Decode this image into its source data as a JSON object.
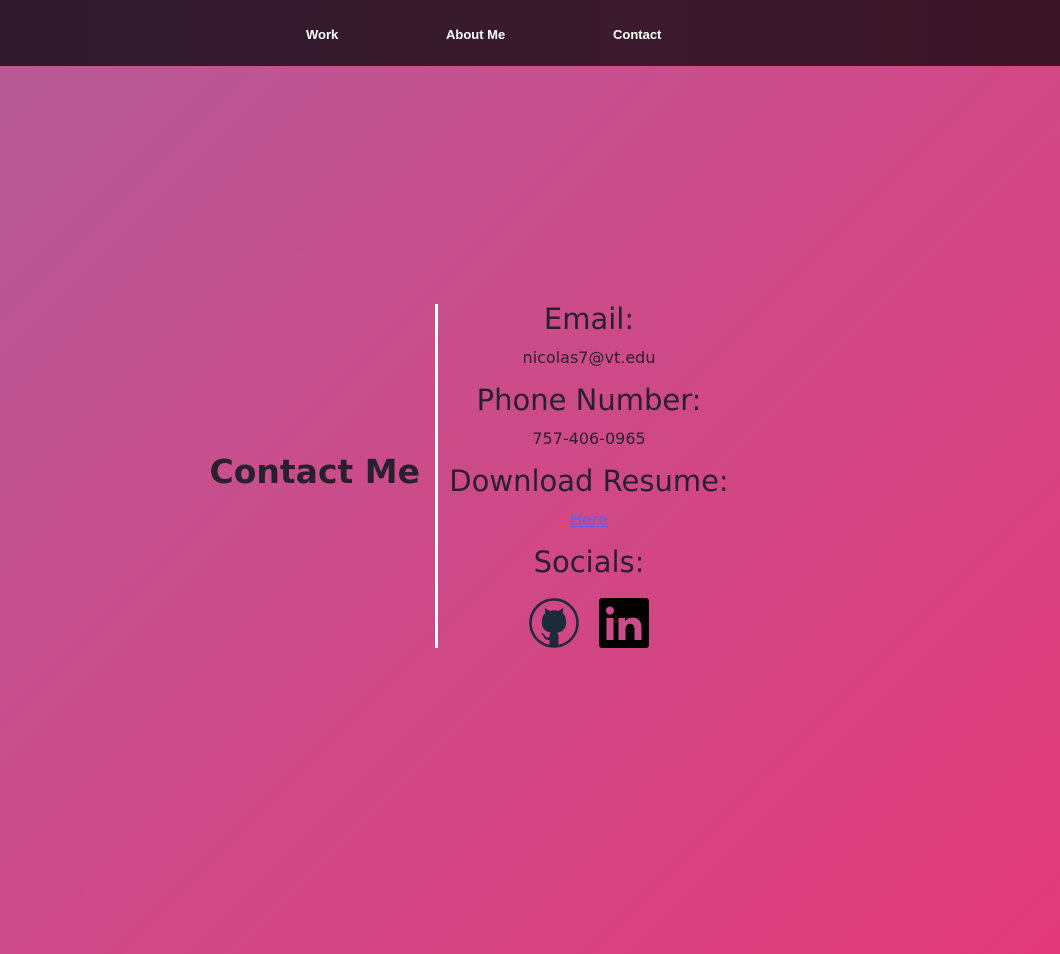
{
  "nav": {
    "items": [
      {
        "label": "Work"
      },
      {
        "label": "About Me"
      },
      {
        "label": "Contact"
      }
    ]
  },
  "contact": {
    "title": "Contact Me",
    "email_heading": "Email:",
    "email_value": "nicolas7@vt.edu",
    "phone_heading": "Phone Number:",
    "phone_value": "757-406-0965",
    "resume_heading": "Download Resume:",
    "resume_link": "Here",
    "socials_heading": "Socials:",
    "socials": [
      {
        "icon": "github-icon"
      },
      {
        "icon": "linkedin-icon"
      }
    ]
  },
  "colors": {
    "nav_background": "#351b2c",
    "gradient_start": "#b45c98",
    "gradient_end": "#e23a78",
    "text_dark": "#2a1f2e",
    "link": "#6060f0",
    "divider": "#ffffff"
  }
}
